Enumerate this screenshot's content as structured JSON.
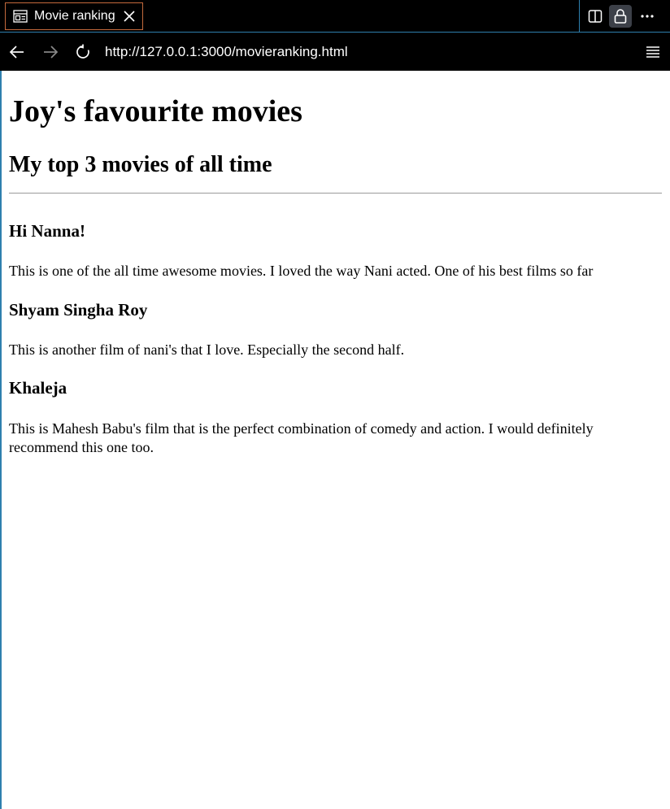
{
  "browser": {
    "tab_title": "Movie ranking",
    "url": "http://127.0.0.1:3000/movieranking.html",
    "icons": [
      "page-icon",
      "close-icon",
      "split-view-icon",
      "lock-icon",
      "more-icon",
      "back-icon",
      "forward-icon",
      "reload-icon",
      "menu-icon"
    ]
  },
  "page": {
    "heading": "Joy's favourite movies",
    "subheading": "My top 3 movies of all time",
    "movies": [
      {
        "title": "Hi Nanna!",
        "description": "This is one of the all time awesome movies. I loved the way Nani acted. One of his best films so far"
      },
      {
        "title": "Shyam Singha Roy",
        "description": "This is another film of nani's that I love. Especially the second half."
      },
      {
        "title": "Khaleja",
        "description": "This is Mahesh Babu's film that is the perfect combination of comedy and action. I would definitely recommend this one too."
      }
    ]
  }
}
